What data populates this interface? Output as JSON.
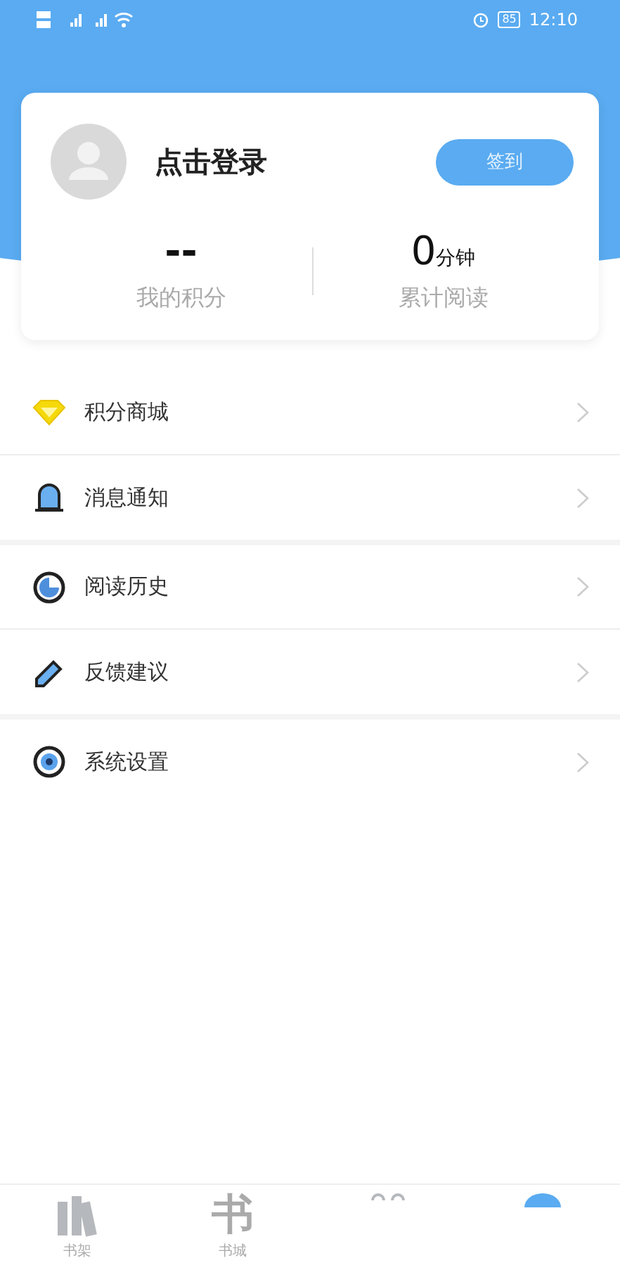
{
  "status_bar": {
    "battery": "85",
    "time": "12:10"
  },
  "profile": {
    "login_label": "点击登录",
    "checkin_button": "签到"
  },
  "stats": [
    {
      "value": "--",
      "label": "我的积分"
    },
    {
      "value": "0",
      "unit_text": "分钟",
      "label": "累计阅读"
    }
  ],
  "menu_groups": [
    [
      {
        "kind": "diamond",
        "label": "积分商城"
      },
      {
        "kind": "bell",
        "label": "消息通知"
      }
    ],
    [
      {
        "kind": "clock",
        "label": "阅读历史"
      },
      {
        "kind": "pencil",
        "label": "反馈建议"
      }
    ],
    [
      {
        "kind": "gear",
        "label": "系统设置"
      }
    ]
  ],
  "tab_bar": [
    {
      "kind": "shelf",
      "label": "书架",
      "selected": false
    },
    {
      "kind": "glyph",
      "glyph": "书",
      "label": "书城",
      "selected": false
    },
    {
      "kind": "eyes",
      "selected": false
    },
    {
      "kind": "circle",
      "selected": true
    }
  ]
}
